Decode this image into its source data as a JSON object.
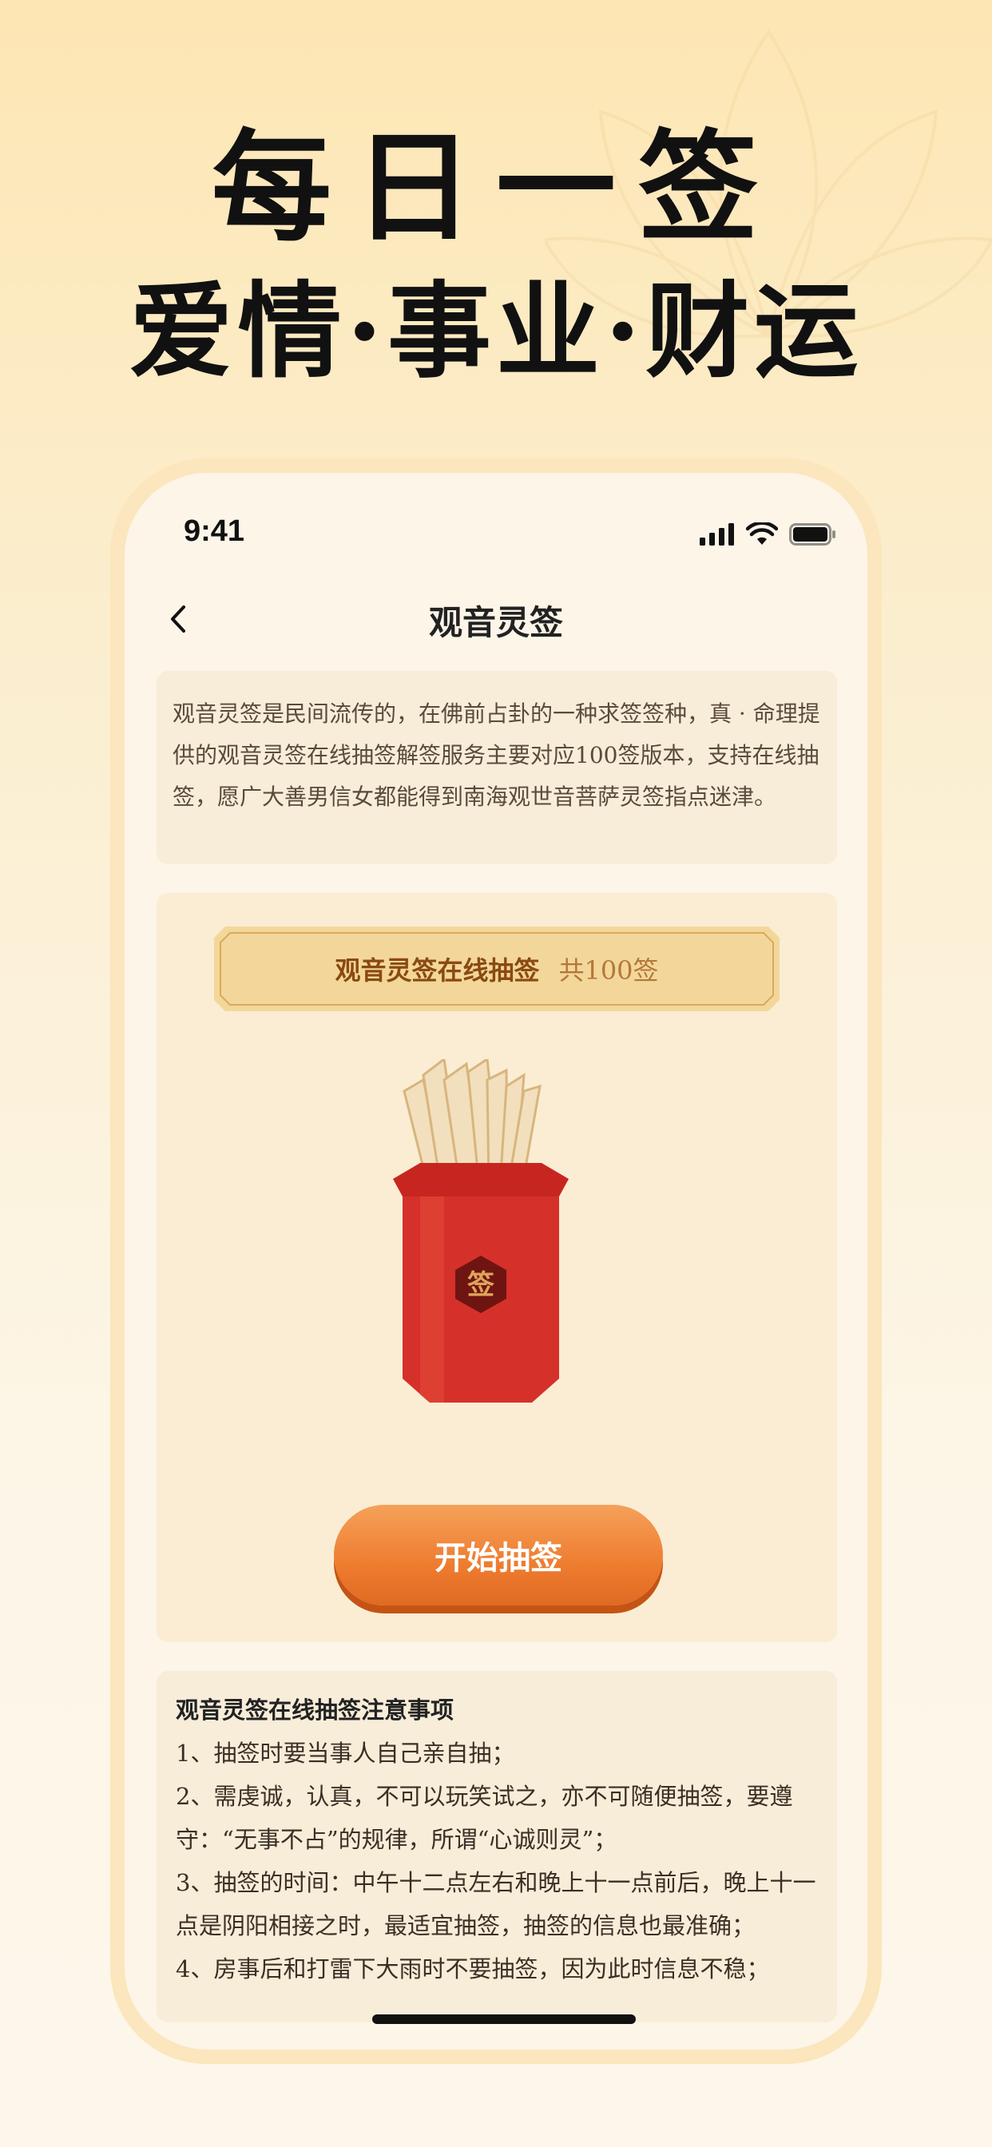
{
  "headline": {
    "line1": "每日一签",
    "line2": "爱情·事业·财运"
  },
  "status_bar": {
    "time": "9:41"
  },
  "nav": {
    "title": "观音灵签"
  },
  "intro": {
    "text": "观音灵签是民间流传的，在佛前占卦的一种求签签种，真 · 命理提供的观音灵签在线抽签解签服务主要对应100签版本，支持在线抽签，愿广大善男信女都能得到南海观世音菩萨灵签指点迷津。"
  },
  "draw": {
    "banner_title": "观音灵签在线抽签",
    "banner_count": "共100签",
    "tube_label": "签",
    "start_label": "开始抽签"
  },
  "notes": {
    "title": "观音灵签在线抽签注意事项",
    "items": [
      "1、抽签时要当事人自己亲自抽；",
      "2、需虔诚，认真，不可以玩笑试之，亦不可随便抽签，要遵守：“无事不占”的规律，所谓“心诚则灵”；",
      "3、抽签的时间：中午十二点左右和晚上十一点前后，晚上十一点是阴阳相接之时，最适宜抽签，抽签的信息也最准确；",
      "4、房事后和打雷下大雨时不要抽签，因为此时信息不稳；"
    ]
  },
  "colors": {
    "accent": "#ee7c2f",
    "banner_gold": "#f3d79a",
    "tube_red": "#d6302a"
  }
}
